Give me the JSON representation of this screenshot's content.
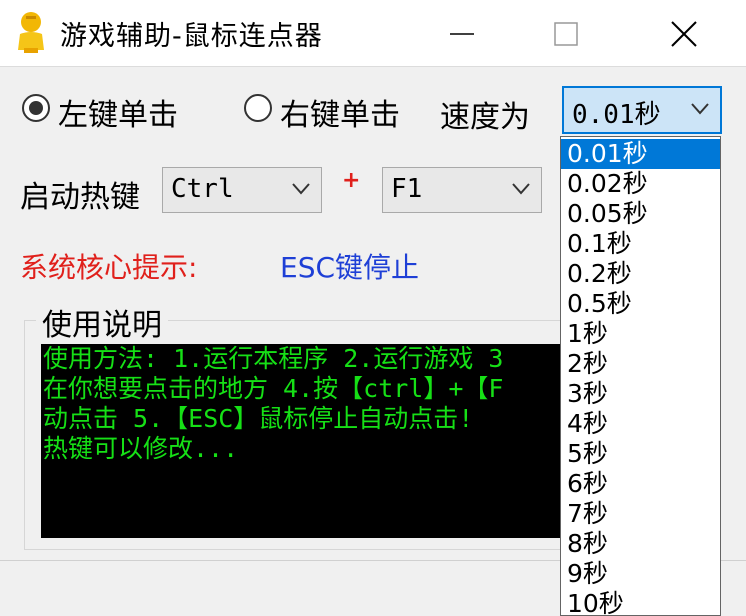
{
  "window": {
    "title": "游戏辅助-鼠标连点器"
  },
  "click_mode": {
    "left_label": "左键单击",
    "right_label": "右键单击",
    "selected": "left"
  },
  "speed": {
    "label": "速度为",
    "selected": "0.01秒",
    "options": [
      "0.01秒",
      "0.02秒",
      "0.05秒",
      "0.1秒",
      "0.2秒",
      "0.5秒",
      "1秒",
      "2秒",
      "3秒",
      "4秒",
      "5秒",
      "6秒",
      "7秒",
      "8秒",
      "9秒",
      "10秒"
    ]
  },
  "hotkey": {
    "label": "启动热键",
    "modifier": "Ctrl",
    "plus": "+",
    "key": "F1"
  },
  "hint": {
    "label": "系统核心提示:",
    "value": "ESC键停止"
  },
  "instructions": {
    "title": "使用说明",
    "lines": [
      "使用方法: 1.运行本程序 2.运行游戏 3",
      "在你想要点击的地方 4.按【ctrl】+【F",
      "动点击 5.【ESC】鼠标停止自动点击!",
      "热键可以修改..."
    ]
  },
  "colors": {
    "accent": "#0078d7",
    "hint_red": "#e0201b",
    "hint_blue": "#1e3fd6",
    "console_green": "#16e016"
  }
}
